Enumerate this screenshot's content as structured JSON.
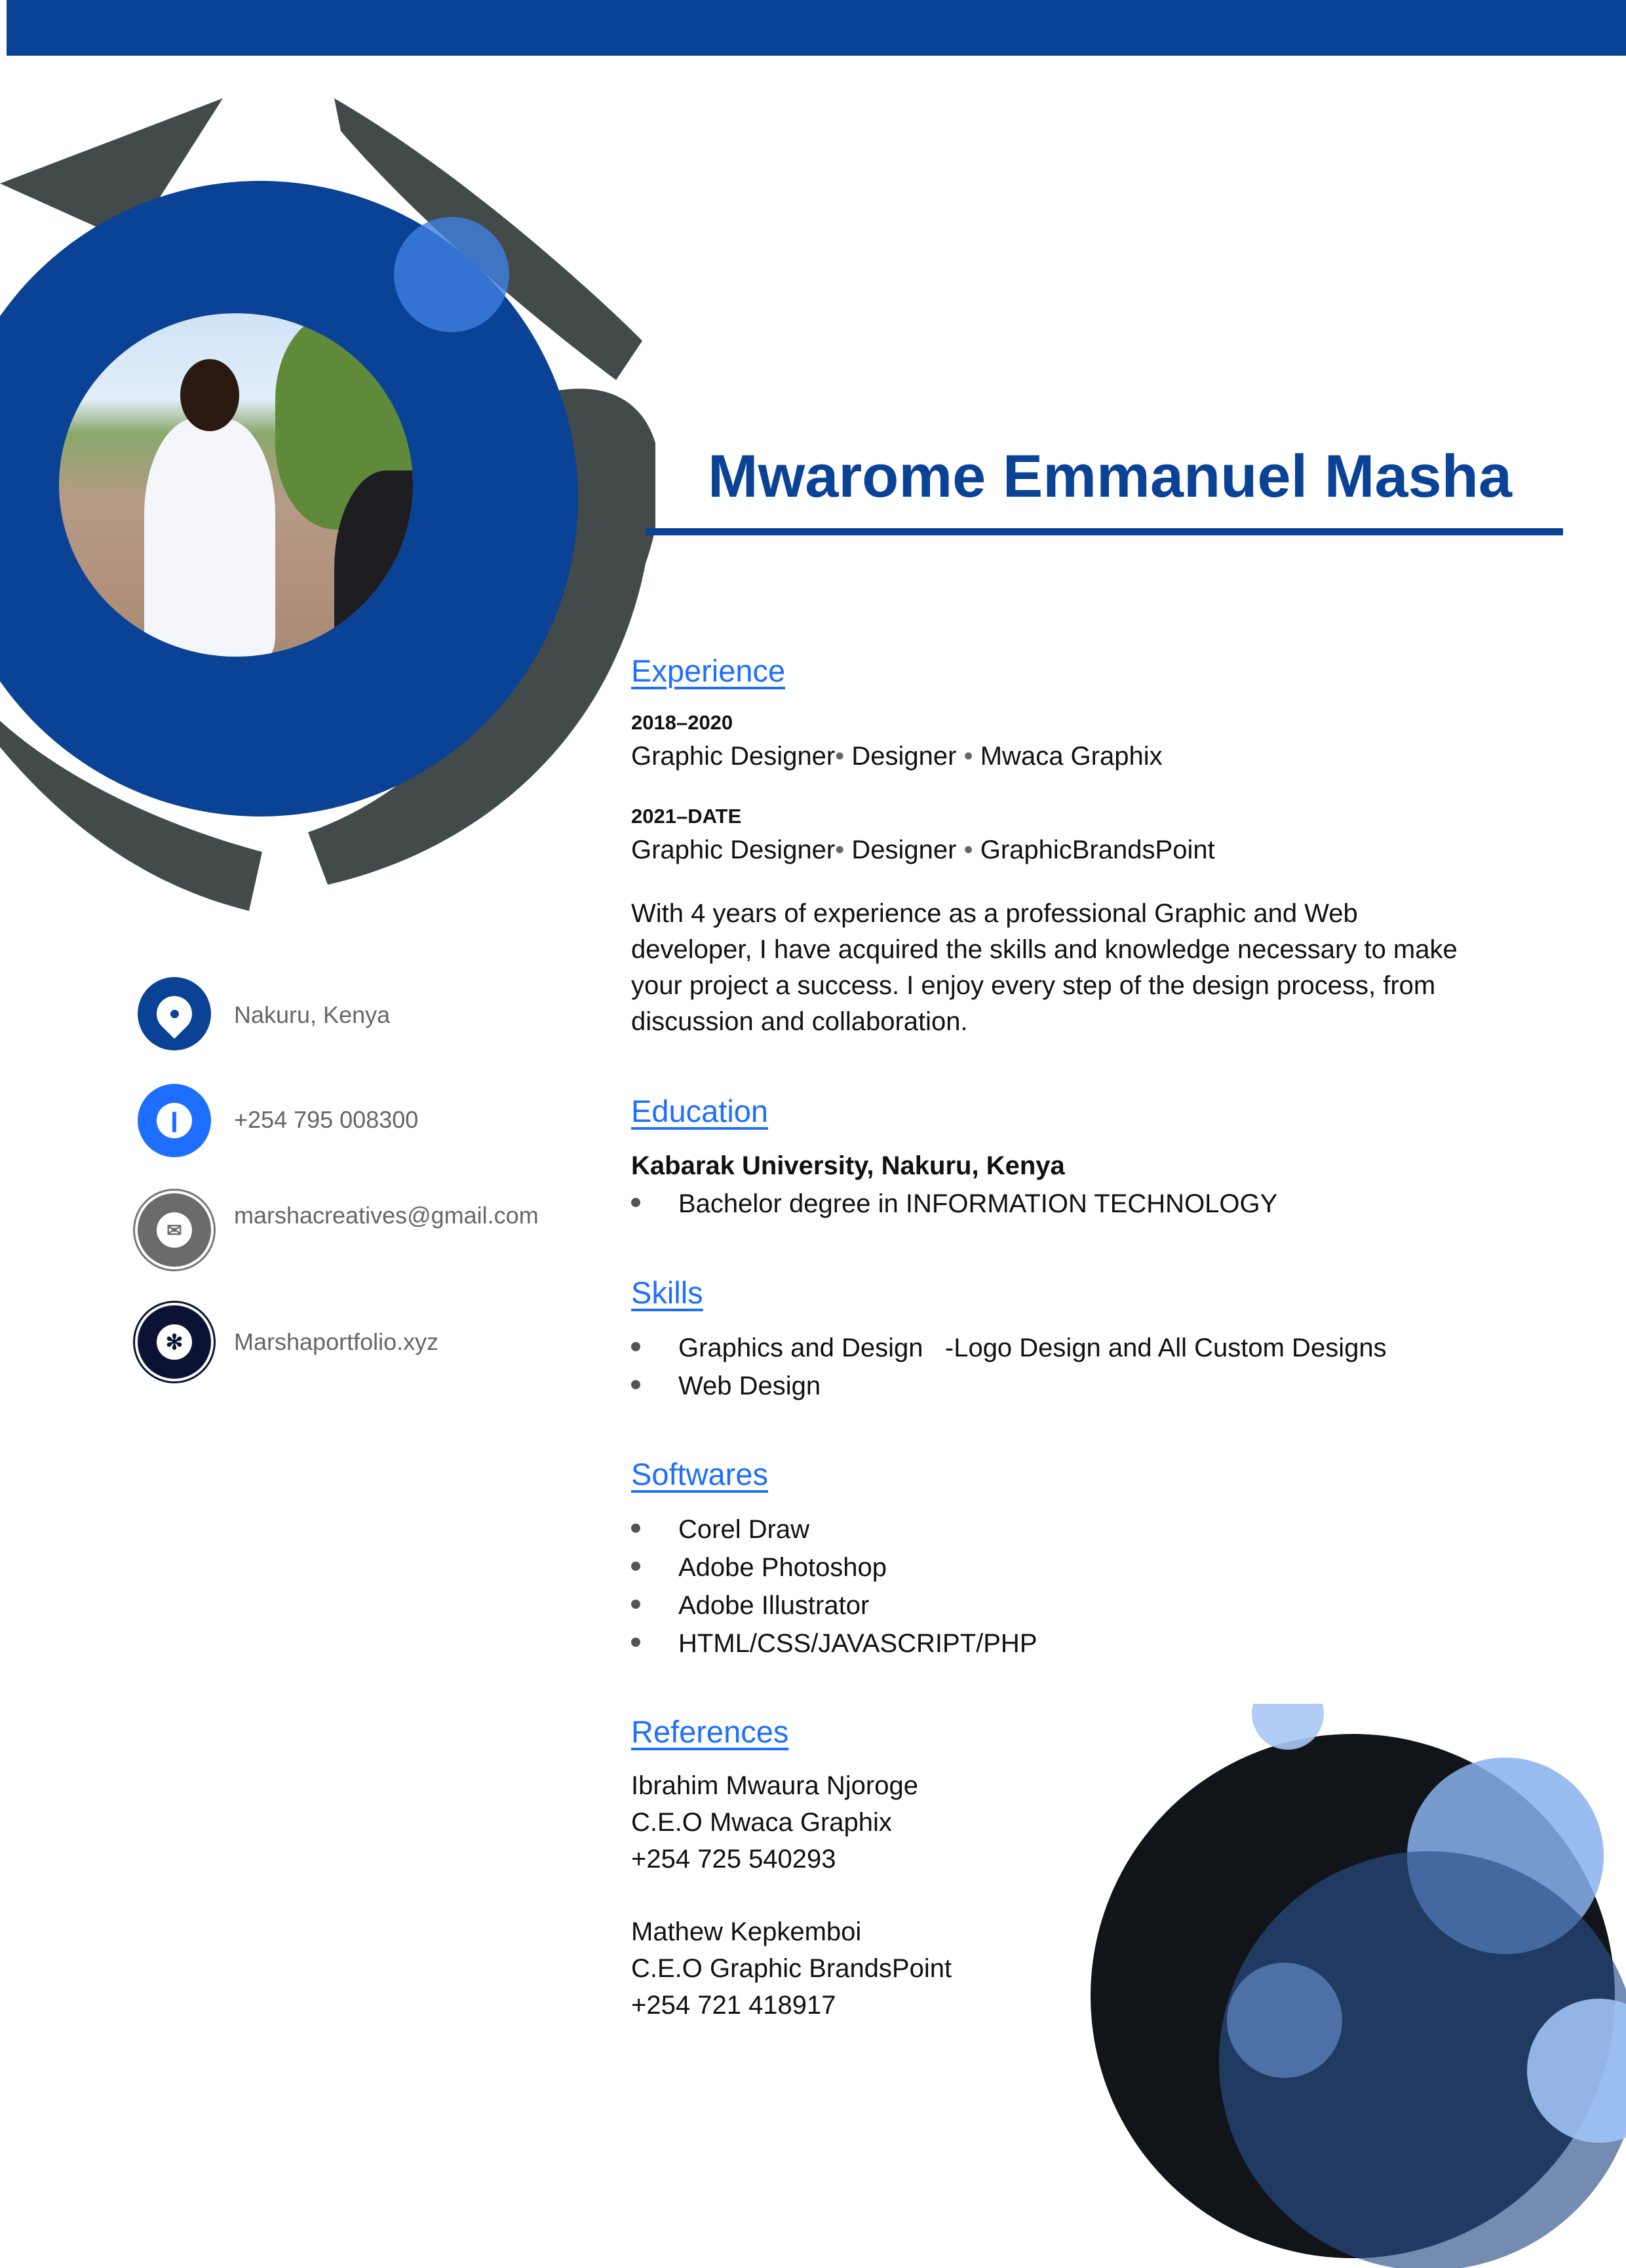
{
  "header": {
    "name": "Mwarome Emmanuel Masha",
    "accent": "#0a4296",
    "link_color": "#1e6fff"
  },
  "contact": [
    {
      "icon": "location-pin-icon",
      "text": "Nakuru, Kenya",
      "color": "#0a4296"
    },
    {
      "icon": "phone-icon",
      "text": "+254 795 008300",
      "color": "#1e6fff"
    },
    {
      "icon": "email-icon",
      "text": "marshacreatives@gmail.com",
      "color": "#6b6b6b"
    },
    {
      "icon": "web-icon",
      "text": "Marshaportfolio.xyz",
      "color": "#0b1233"
    }
  ],
  "experience": {
    "heading": "Experience",
    "jobs": [
      {
        "dates": "2018–2020",
        "role": "Graphic Designer",
        "sep1": "•",
        "title": "Designer",
        "sep2": "•",
        "company": "Mwaca Graphix"
      },
      {
        "dates": "2021–DATE",
        "role": "Graphic Designer",
        "sep1": "•",
        "title": "Designer",
        "sep2": "•",
        "company": "GraphicBrandsPoint"
      }
    ],
    "summary": [
      "With 4 years of experience as a professional Graphic and Web",
      "developer, I have acquired the skills and knowledge necessary to make",
      "your project a success. I enjoy every step of the design process, from",
      "discussion and collaboration."
    ]
  },
  "education": {
    "heading": "Education",
    "school": "Kabarak University, Nakuru, Kenya",
    "items": [
      "Bachelor degree in INFORMATION TECHNOLOGY"
    ]
  },
  "skills": {
    "heading": "Skills",
    "items": [
      "Graphics and Design   -Logo Design and All Custom Designs",
      "Web Design"
    ]
  },
  "softwares": {
    "heading": "Softwares",
    "items": [
      "Corel Draw",
      "Adobe Photoshop",
      "Adobe Illustrator",
      "HTML/CSS/JAVASCRIPT/PHP"
    ]
  },
  "references": {
    "heading": "References",
    "people": [
      {
        "name": "Ibrahim Mwaura Njoroge",
        "title": "C.E.O Mwaca Graphix",
        "phone": "+254 725 540293"
      },
      {
        "name": "Mathew Kepkemboi",
        "title": "C.E.O Graphic BrandsPoint",
        "phone": "+254 721 418917"
      }
    ]
  }
}
